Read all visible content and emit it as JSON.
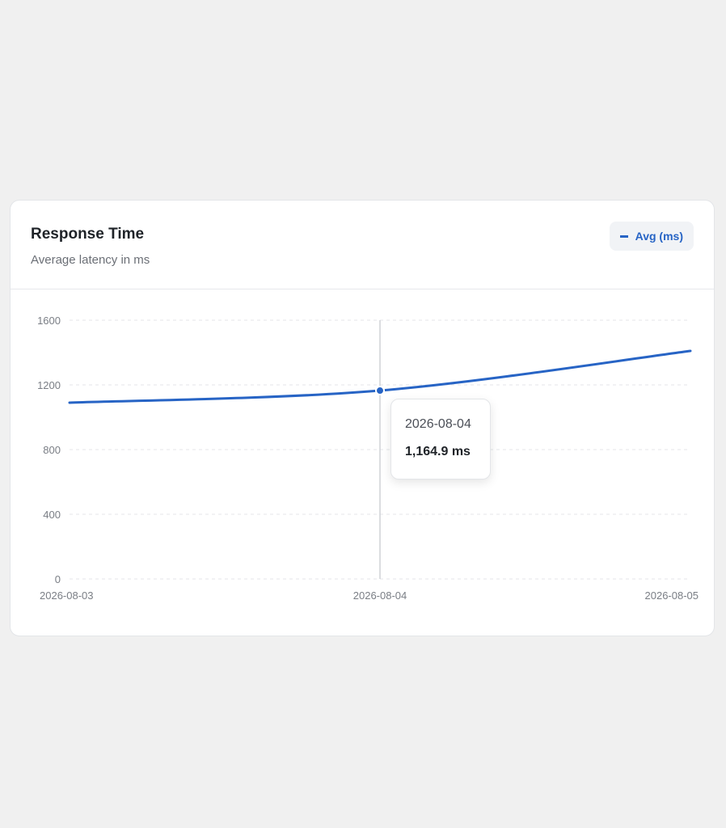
{
  "card": {
    "title": "Response Time",
    "subtitle": "Average latency in ms",
    "legend_label": "Avg (ms)"
  },
  "tooltip": {
    "date": "2026-08-04",
    "value": "1,164.9 ms"
  },
  "colors": {
    "series": "#2764c5",
    "grid": "#e4e6ea",
    "crosshair": "#cfd2d6",
    "tick_text": "#7a7e85"
  },
  "chart_data": {
    "type": "line",
    "title": "Response Time",
    "subtitle": "Average latency in ms",
    "x": [
      "2026-08-03",
      "2026-08-04",
      "2026-08-05"
    ],
    "x_tick_labels": [
      "2026-08-03",
      "2026-08-04",
      "2026-08-05"
    ],
    "y_ticks": [
      0,
      400,
      800,
      1200,
      1600
    ],
    "ylim": [
      0,
      1600
    ],
    "grid": true,
    "legend": "top-right",
    "series": [
      {
        "name": "Avg (ms)",
        "values": [
          1090,
          1164.9,
          1410
        ]
      }
    ],
    "hovered_index": 1
  }
}
